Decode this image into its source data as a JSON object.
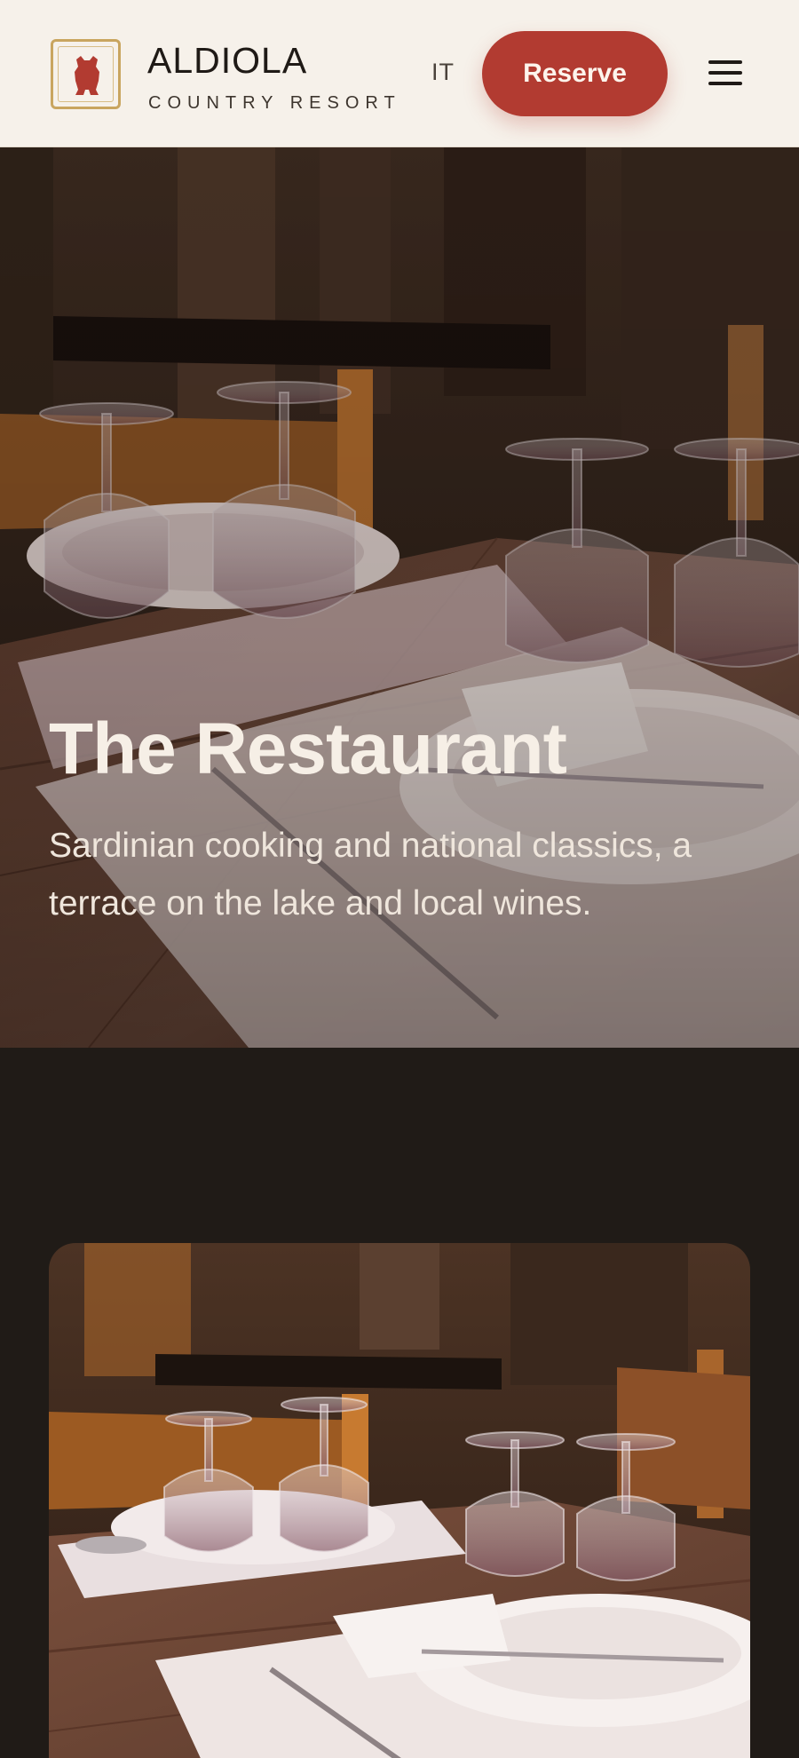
{
  "header": {
    "brand_name": "ALDIOLA",
    "brand_tagline": "COUNTRY RESORT",
    "logo_icon": "boar-crest-icon",
    "language_link": "IT",
    "reserve_label": "Reserve",
    "menu_icon": "hamburger-menu-icon"
  },
  "hero": {
    "title": "The Restaurant",
    "subtitle": "Sardinian cooking and national classics, a terrace on the lake and local wines.",
    "image": "restaurant-table-photo"
  },
  "content": {
    "image": "restaurant-table-photo"
  },
  "colors": {
    "accent": "#b23b31",
    "header_bg": "#f6f1ea",
    "page_bg": "#201b17",
    "logo_gold": "#c9a55f",
    "hero_text": "#f6efe6"
  }
}
